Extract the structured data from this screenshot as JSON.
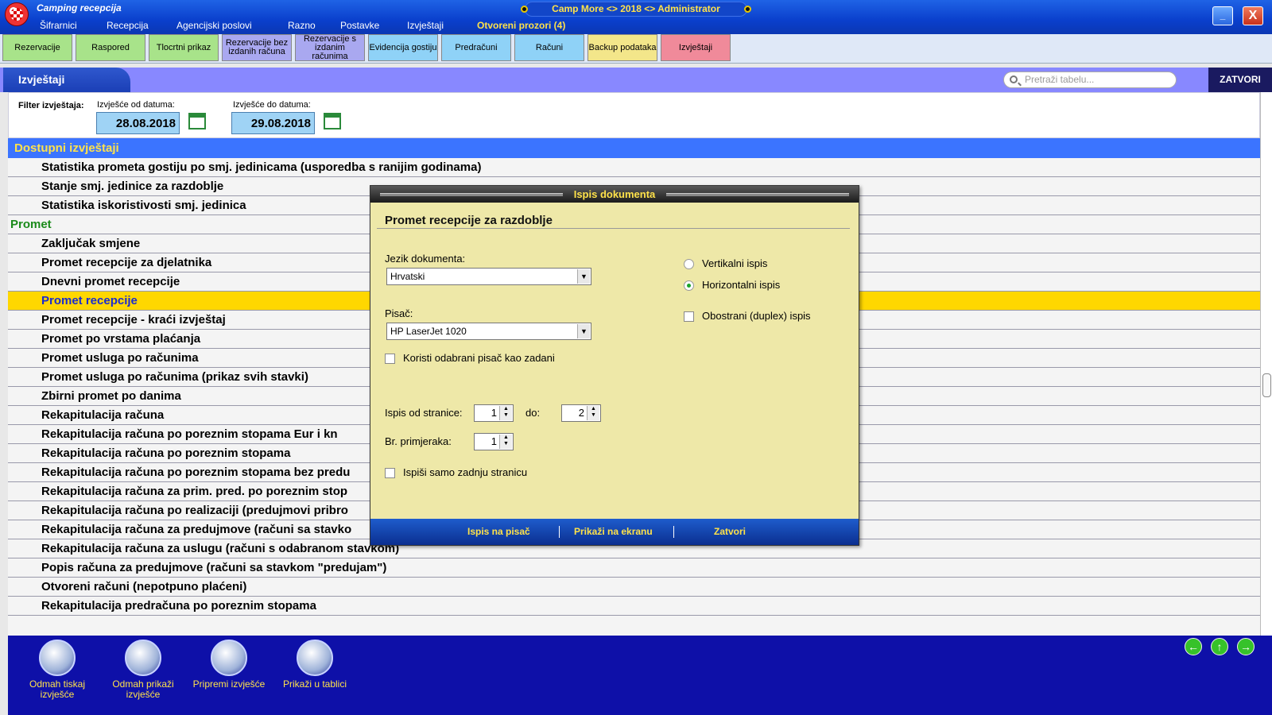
{
  "window": {
    "app_name": "Camping recepcija",
    "center_title": "Camp More <> 2018 <> Administrator",
    "minimize": "_",
    "close": "X"
  },
  "menu": [
    "Šifrarnici",
    "Recepcija",
    "Agencijski poslovi",
    "Razno",
    "Postavke",
    "Izvještaji",
    "Otvoreni prozori (4)"
  ],
  "toolbar": [
    {
      "label": "Rezervacije",
      "color": "#a8e38a"
    },
    {
      "label": "Raspored",
      "color": "#a8e38a"
    },
    {
      "label": "Tlocrtni prikaz",
      "color": "#a8e38a"
    },
    {
      "label": "Rezervacije bez izdanih računa",
      "color": "#a9a8f0"
    },
    {
      "label": "Rezervacije s izdanim računima",
      "color": "#a9a8f0"
    },
    {
      "label": "Evidencija gostiju",
      "color": "#8fd2f7"
    },
    {
      "label": "Predračuni",
      "color": "#8fd2f7"
    },
    {
      "label": "Računi",
      "color": "#8fd2f7"
    },
    {
      "label": "Backup podataka",
      "color": "#f3e68a"
    },
    {
      "label": "Izvještaji",
      "color": "#f08a9a"
    }
  ],
  "section": {
    "title": "Izvještaji",
    "search_placeholder": "Pretraži tabelu...",
    "close_label": "ZATVORI"
  },
  "filter": {
    "label": "Filter izvještaja:",
    "from_label": "Izvješće od datuma:",
    "from_value": "28.08.2018",
    "to_label": "Izvješće do datuma:",
    "to_value": "29.08.2018"
  },
  "list": {
    "header": "Dostupni izvještaji",
    "rows": [
      {
        "text": "Statistika prometa gostiju po smj. jedinicama (usporedba s ranijim godinama)",
        "type": "item"
      },
      {
        "text": "Stanje smj. jedinice za razdoblje",
        "type": "item"
      },
      {
        "text": "Statistika iskoristivosti smj. jedinica",
        "type": "item"
      },
      {
        "text": "Promet",
        "type": "group"
      },
      {
        "text": "Zaključak smjene",
        "type": "item"
      },
      {
        "text": "Promet recepcije za djelatnika",
        "type": "item"
      },
      {
        "text": "Dnevni promet recepcije",
        "type": "item"
      },
      {
        "text": "Promet recepcije",
        "type": "selected"
      },
      {
        "text": "Promet recepcije - kraći izvještaj",
        "type": "item"
      },
      {
        "text": "Promet po vrstama plaćanja",
        "type": "item"
      },
      {
        "text": "Promet usluga po računima",
        "type": "item"
      },
      {
        "text": "Promet usluga po računima (prikaz svih stavki)",
        "type": "item"
      },
      {
        "text": "Zbirni promet po danima",
        "type": "item"
      },
      {
        "text": "Rekapitulacija računa",
        "type": "item"
      },
      {
        "text": "Rekapitulacija računa po poreznim stopama Eur i kn",
        "type": "item"
      },
      {
        "text": "Rekapitulacija računa po poreznim stopama",
        "type": "item"
      },
      {
        "text": "Rekapitulacija računa po poreznim stopama bez predu",
        "type": "item"
      },
      {
        "text": "Rekapitulacija računa za prim. pred. po poreznim stop",
        "type": "item"
      },
      {
        "text": "Rekapitulacija računa po realizaciji (predujmovi pribro",
        "type": "item"
      },
      {
        "text": "Rekapitulacija računa za predujmove (računi sa stavko",
        "type": "item"
      },
      {
        "text": "Rekapitulacija računa za uslugu (računi s odabranom stavkom)",
        "type": "item"
      },
      {
        "text": "Popis računa za predujmove (računi sa stavkom \"predujam\")",
        "type": "item"
      },
      {
        "text": "Otvoreni računi (nepotpuno plaćeni)",
        "type": "item"
      },
      {
        "text": "Rekapitulacija predračuna po poreznim stopama",
        "type": "item"
      }
    ]
  },
  "bottom_buttons": [
    {
      "label": "Odmah tiskaj izvješće",
      "icon": "printer-icon"
    },
    {
      "label": "Odmah prikaži izvješće",
      "icon": "preview-icon"
    },
    {
      "label": "Pripremi izvješće",
      "icon": "prepare-icon"
    },
    {
      "label": "Prikaži u tablici",
      "icon": "table-icon"
    }
  ],
  "nav_arrows": [
    "←",
    "↑",
    "→"
  ],
  "dialog": {
    "title": "Ispis dokumenta",
    "heading": "Promet recepcije za razdoblje",
    "language_label": "Jezik dokumenta:",
    "language_value": "Hrvatski",
    "printer_label": "Pisač:",
    "printer_value": "HP LaserJet 1020",
    "default_printer_label": "Koristi odabrani pisač kao zadani",
    "vertical_label": "Vertikalni ispis",
    "horizontal_label": "Horizontalni ispis",
    "duplex_label": "Obostrani (duplex) ispis",
    "from_page_label": "Ispis od stranice:",
    "from_page_value": "1",
    "to_label": "do:",
    "to_page_value": "2",
    "copies_label": "Br. primjeraka:",
    "copies_value": "1",
    "last_page_label": "Ispiši samo zadnju stranicu",
    "btn_print": "Ispis na pisač",
    "btn_screen": "Prikaži na ekranu",
    "btn_close": "Zatvori"
  }
}
